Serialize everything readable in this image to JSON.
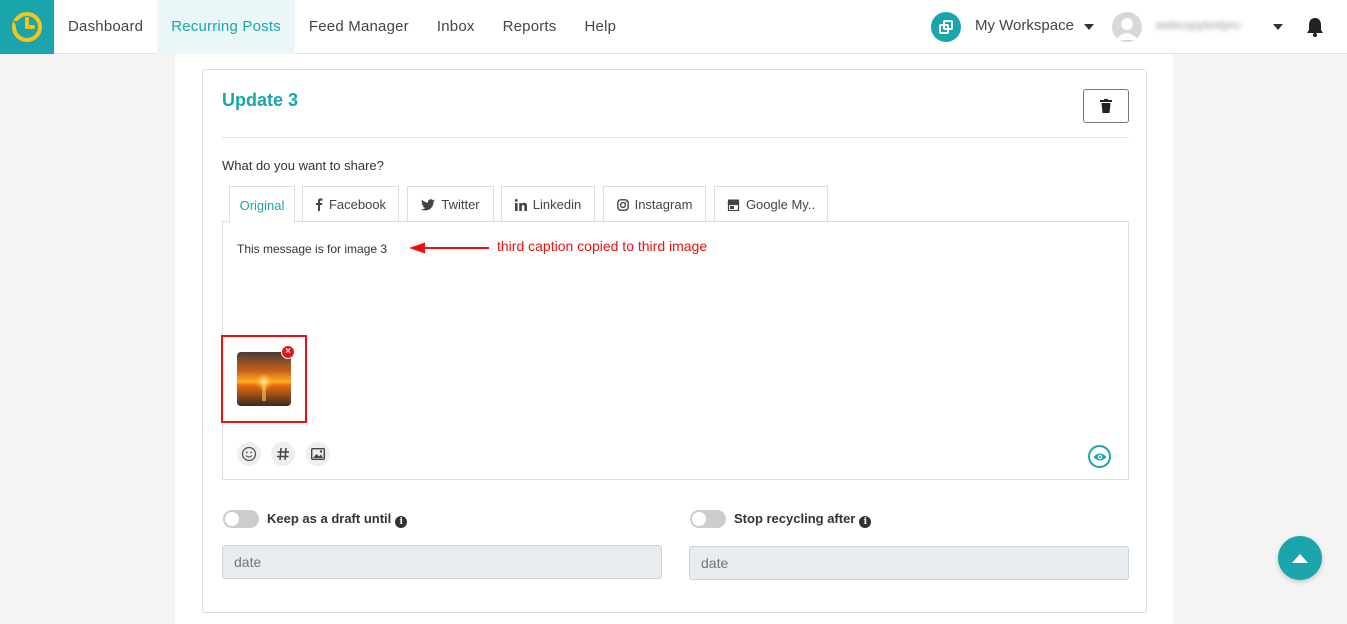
{
  "nav": {
    "items": [
      {
        "label": "Dashboard",
        "active": false
      },
      {
        "label": "Recurring Posts",
        "active": true
      },
      {
        "label": "Feed Manager",
        "active": false
      },
      {
        "label": "Inbox",
        "active": false
      },
      {
        "label": "Reports",
        "active": false
      },
      {
        "label": "Help",
        "active": false
      }
    ],
    "workspace_label": "My Workspace",
    "user_name": "webcopytextpro"
  },
  "card": {
    "title": "Update 3",
    "share_label": "What do you want to share?",
    "tabs": [
      {
        "label": "Original",
        "icon": "none",
        "active": true
      },
      {
        "label": "Facebook",
        "icon": "facebook-icon"
      },
      {
        "label": "Twitter",
        "icon": "twitter-icon"
      },
      {
        "label": "Linkedin",
        "icon": "linkedin-icon"
      },
      {
        "label": "Instagram",
        "icon": "instagram-icon"
      },
      {
        "label": "Google My..",
        "icon": "google-my-business-icon"
      }
    ],
    "message": "This message is for image 3",
    "annotation": "third caption copied to third image",
    "tools": [
      "emoji-icon",
      "hashtag-icon",
      "image-icon"
    ],
    "draft": {
      "label": "Keep as a draft until",
      "placeholder": "date",
      "enabled": false
    },
    "stop": {
      "label": "Stop recycling after",
      "placeholder": "date",
      "enabled": false
    }
  },
  "colors": {
    "accent": "#1aa5ad",
    "annotation": "#ee1111"
  }
}
